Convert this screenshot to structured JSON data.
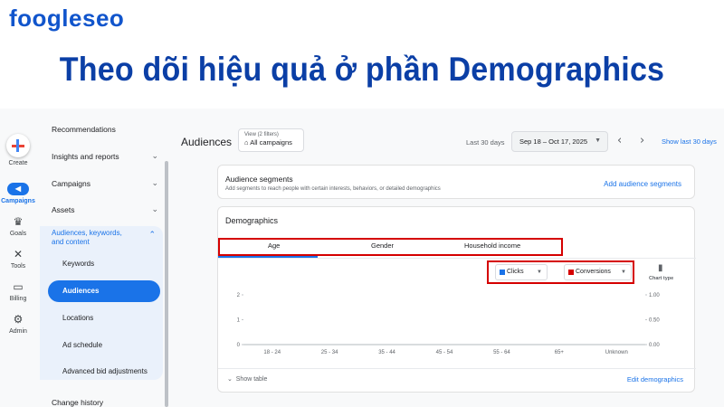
{
  "banner": {
    "logo_main": "foogle",
    "logo_seo": "seo",
    "headline": "Theo dõi hiệu quả ở phần Demographics"
  },
  "rail": {
    "create": "Create",
    "campaigns": "Campaigns",
    "goals": "Goals",
    "tools": "Tools",
    "billing": "Billing",
    "admin": "Admin"
  },
  "nav": {
    "recommendations": "Recommendations",
    "insights": "Insights and reports",
    "campaigns": "Campaigns",
    "assets": "Assets",
    "audiences_group": "Audiences, keywords, and content",
    "keywords": "Keywords",
    "audiences": "Audiences",
    "locations": "Locations",
    "ad_schedule": "Ad schedule",
    "bid_adjustments": "Advanced bid adjustments",
    "change_history": "Change history"
  },
  "header": {
    "title": "Audiences",
    "view_small": "View (2 filters)",
    "view_value": "All campaigns",
    "date_label": "Last 30 days",
    "date_range": "Sep 18 – Oct 17, 2025",
    "show_last": "Show last 30 days"
  },
  "segments": {
    "title": "Audience segments",
    "description": "Add segments to reach people with certain interests, behaviors, or detailed demographics",
    "add_link": "Add audience segments"
  },
  "demographics": {
    "title": "Demographics",
    "tabs": [
      "Age",
      "Gender",
      "Household income"
    ],
    "metric_1": "Clicks",
    "metric_2": "Conversions",
    "chart_type_label": "Chart type",
    "show_table": "Show table",
    "edit_link": "Edit demographics"
  },
  "colors": {
    "accent": "#1a73e8",
    "clicks": "#1a73e8",
    "conversions": "#d50000",
    "highlight": "#d50000",
    "headline": "#0b3fa6"
  },
  "chart_data": {
    "type": "bar",
    "categories": [
      "18 - 24",
      "25 - 34",
      "35 - 44",
      "45 - 54",
      "55 - 64",
      "65+",
      "Unknown"
    ],
    "series": [
      {
        "name": "Clicks",
        "values": [
          0,
          0,
          0,
          0,
          0,
          0,
          0
        ]
      },
      {
        "name": "Conversions",
        "values": [
          0,
          0,
          0,
          0,
          0,
          0,
          0
        ]
      }
    ],
    "y_left_ticks": [
      "0",
      "1",
      "2"
    ],
    "y_right_ticks": [
      "0.00",
      "0.50",
      "1.00"
    ],
    "ylim_left": [
      0,
      2
    ],
    "ylim_right": [
      0,
      1
    ],
    "grid": false
  }
}
